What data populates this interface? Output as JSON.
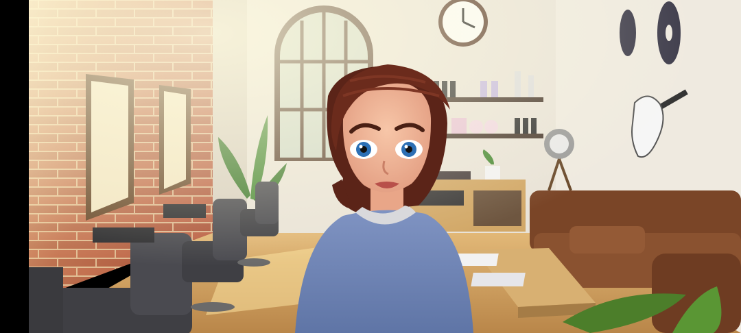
{
  "game": {
    "scene": "hair-salon-interior",
    "character": "client-girl-in-cape"
  },
  "colors": {
    "brick": "#b5543b",
    "brick_dark": "#8e3f2c",
    "mortar": "#d9b28e",
    "wall": "#e7e1d6",
    "floor": "#c79a5c",
    "sofa": "#7a4527",
    "cape": "#6f84b3",
    "hair": "#5b2418",
    "skin": "#f0b597"
  },
  "icons": [
    "wall-clock-icon",
    "vinyl-record-icon",
    "electric-guitar-icon",
    "studio-light-icon",
    "plant-icon"
  ]
}
